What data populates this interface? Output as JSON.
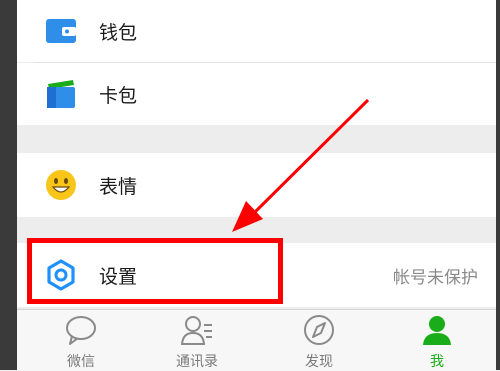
{
  "menu": {
    "wallet_label": "钱包",
    "cards_label": "卡包",
    "stickers_label": "表情",
    "settings_label": "设置",
    "settings_status": "帐号未保护"
  },
  "tabbar": {
    "tabs": [
      {
        "label": "微信",
        "icon": "chat-bubble-icon",
        "active": false
      },
      {
        "label": "通讯录",
        "icon": "contacts-icon",
        "active": false
      },
      {
        "label": "发现",
        "icon": "compass-icon",
        "active": false
      },
      {
        "label": "我",
        "icon": "person-icon",
        "active": true
      }
    ]
  },
  "colors": {
    "accent_green": "#1aad19",
    "wallet_blue": "#2f8fe8",
    "emoji_yellow": "#f8c519",
    "settings_blue": "#1e90ff",
    "annotation_red": "#ff0000"
  }
}
